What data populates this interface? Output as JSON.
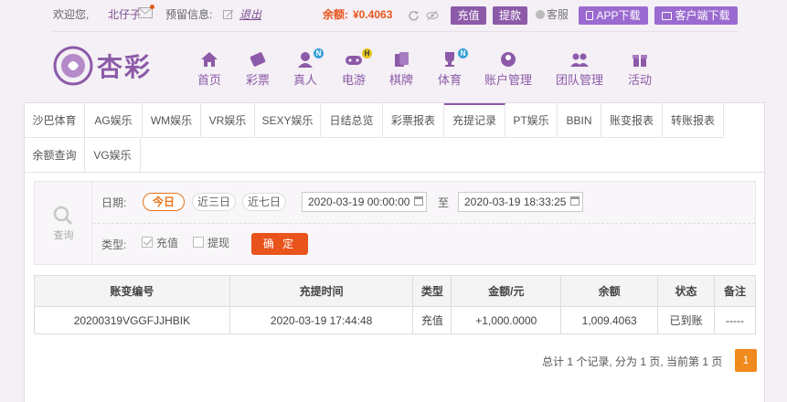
{
  "topbar": {
    "welcome": "欢迎您,",
    "username": "北仔子",
    "reserve_label": "预留信息:",
    "logout": "退出",
    "balance_label": "余额:",
    "balance_value": "¥0.4063",
    "recharge": "充值",
    "withdraw": "提款",
    "service": "客服",
    "app_download": "APP下载",
    "client_download": "客户端下载"
  },
  "logo": {
    "text": "杏彩"
  },
  "nav": [
    {
      "label": "首页",
      "icon": "home-icon"
    },
    {
      "label": "彩票",
      "icon": "lottery-ticket-icon"
    },
    {
      "label": "真人",
      "icon": "live-dealer-icon",
      "badge": "N"
    },
    {
      "label": "电游",
      "icon": "gamepad-icon",
      "badge": "H"
    },
    {
      "label": "棋牌",
      "icon": "cards-icon"
    },
    {
      "label": "体育",
      "icon": "trophy-icon",
      "badge": "N"
    },
    {
      "label": "账户管理",
      "icon": "account-icon"
    },
    {
      "label": "团队管理",
      "icon": "team-icon"
    },
    {
      "label": "活动",
      "icon": "gift-icon"
    }
  ],
  "tabs_row1": [
    "沙巴体育",
    "AG娱乐",
    "WM娱乐",
    "VR娱乐",
    "SEXY娱乐",
    "日结总览",
    "彩票报表",
    "充提记录",
    "PT娱乐",
    "BBIN",
    "账变报表",
    "转账报表"
  ],
  "tabs_row2": [
    "余额查询",
    "VG娱乐"
  ],
  "active_tab": "充提记录",
  "filter": {
    "query_label": "查询",
    "date_label": "日期:",
    "pills": [
      "今日",
      "近三日",
      "近七日"
    ],
    "start": "2020-03-19 00:00:00",
    "to": "至",
    "end": "2020-03-19 18:33:25",
    "type_label": "类型:",
    "type_recharge": "充值",
    "type_withdraw": "提现",
    "confirm": "确 定"
  },
  "table": {
    "headers": [
      "账变编号",
      "充提时间",
      "类型",
      "金额/元",
      "余额",
      "状态",
      "备注"
    ],
    "rows": [
      [
        "20200319VGGFJJHBIK",
        "2020-03-19 17:44:48",
        "充值",
        "+1,000.0000",
        "1,009.4063",
        "已到账",
        "-----"
      ]
    ]
  },
  "pager": {
    "summary": "总计 1 个记录, 分为 1 页, 当前第 1 页",
    "current": "1"
  },
  "colors": {
    "brand": "#8c5aa8",
    "accent": "#e8541c",
    "success": "#3a9a2a"
  }
}
